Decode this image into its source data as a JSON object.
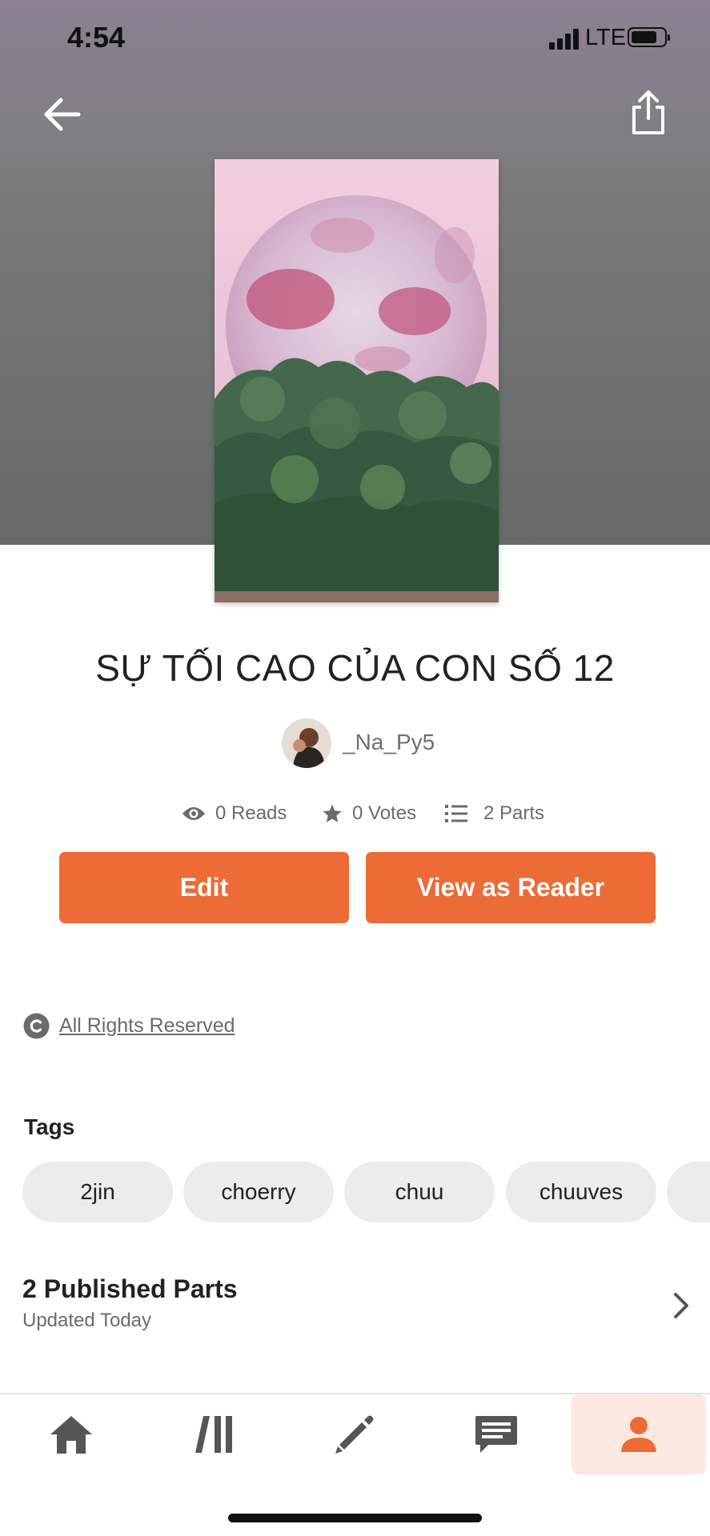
{
  "status_bar": {
    "time": "4:54",
    "network": "LTE"
  },
  "story": {
    "title": "SỰ TỐI CAO CỦA CON SỐ 12",
    "author": "_Na_Py5",
    "stats": {
      "reads": "0 Reads",
      "votes": "0 Votes",
      "parts": "2 Parts"
    }
  },
  "actions": {
    "edit_label": "Edit",
    "view_label": "View as Reader"
  },
  "copyright": {
    "label": "All Rights Reserved"
  },
  "tags": {
    "heading": "Tags",
    "items": [
      "2jin",
      "choerry",
      "chuu",
      "chuuves"
    ]
  },
  "parts": {
    "title": "2 Published Parts",
    "subtitle": "Updated Today"
  },
  "nav": {
    "tabs": [
      {
        "icon": "home-icon"
      },
      {
        "icon": "library-icon"
      },
      {
        "icon": "pencil-icon"
      },
      {
        "icon": "messages-icon"
      },
      {
        "icon": "profile-icon",
        "active": true
      }
    ]
  },
  "colors": {
    "accent": "#ec6b36",
    "active_tab_bg": "#fde9df",
    "tag_bg": "#ececec"
  }
}
